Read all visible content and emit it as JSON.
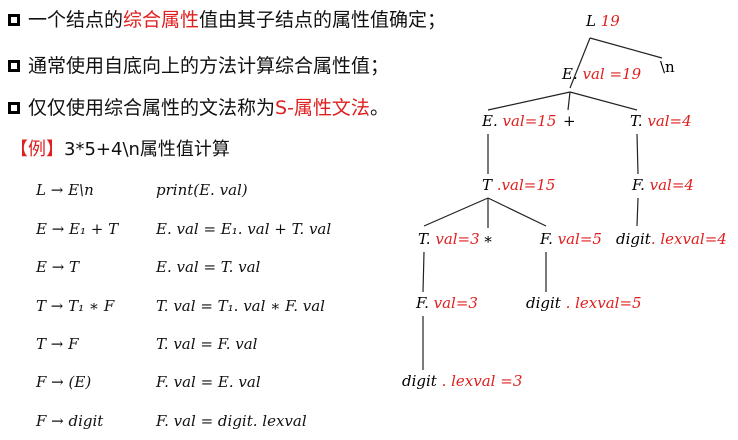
{
  "bullets": [
    {
      "before": "一个结点的",
      "highlight": "综合属性",
      "after": "值由其子结点的属性值确定；"
    },
    {
      "before": "通常使用自底向上的方法计算综合属性值；",
      "highlight": "",
      "after": ""
    },
    {
      "before": "仅仅使用综合属性的文法称为",
      "highlight": "S-属性文法",
      "after": "。"
    }
  ],
  "example": {
    "bracket": "【例】",
    "text": "3*5+4\\n属性值计算"
  },
  "rules": [
    {
      "production": "L → E\\n",
      "action": "print(E. val)"
    },
    {
      "production": "E → E₁ + T",
      "action": "E. val = E₁. val + T. val"
    },
    {
      "production": "E → T",
      "action": "E. val = T. val"
    },
    {
      "production": "T → T₁ ∗ F",
      "action": "T. val = T₁. val ∗ F. val"
    },
    {
      "production": "T → F",
      "action": "T. val = F. val"
    },
    {
      "production": "F → (E)",
      "action": "F. val = E. val"
    },
    {
      "production": "F → digit",
      "action": "F. val = digit. lexval"
    }
  ],
  "tree": {
    "nodes": [
      {
        "id": "L",
        "sym": "L",
        "attr": " 19"
      },
      {
        "id": "E1",
        "sym": "E.",
        "attr": " val =19"
      },
      {
        "id": "NL",
        "sym": "\\n",
        "attr": ""
      },
      {
        "id": "E2",
        "sym": "E.",
        "attr": " val=15"
      },
      {
        "id": "PLUS",
        "sym": "+",
        "attr": ""
      },
      {
        "id": "T1",
        "sym": "T.",
        "attr": " val=4"
      },
      {
        "id": "T2",
        "sym": "T",
        "attr": " .val=15"
      },
      {
        "id": "F1",
        "sym": "F.",
        "attr": " val=4"
      },
      {
        "id": "T3",
        "sym": "T.",
        "attr": " val=3"
      },
      {
        "id": "STAR",
        "sym": "∗",
        "attr": ""
      },
      {
        "id": "F2",
        "sym": "F.",
        "attr": " val=5"
      },
      {
        "id": "D1",
        "sym": "digit",
        "attr": ". lexval=4"
      },
      {
        "id": "F3",
        "sym": "F.",
        "attr": " val=3"
      },
      {
        "id": "D2",
        "sym": "digit",
        "attr": " . lexval=5"
      },
      {
        "id": "D3",
        "sym": "digit",
        "attr": " . lexval =3"
      }
    ],
    "edges": [
      [
        "L",
        "E1"
      ],
      [
        "L",
        "NL"
      ],
      [
        "E1",
        "E2"
      ],
      [
        "E1",
        "PLUS"
      ],
      [
        "E1",
        "T1"
      ],
      [
        "E2",
        "T2"
      ],
      [
        "T1",
        "F1"
      ],
      [
        "T2",
        "T3"
      ],
      [
        "T2",
        "STAR"
      ],
      [
        "T2",
        "F2"
      ],
      [
        "F1",
        "D1"
      ],
      [
        "T3",
        "F3"
      ],
      [
        "F2",
        "D2"
      ],
      [
        "F3",
        "D3"
      ]
    ]
  }
}
